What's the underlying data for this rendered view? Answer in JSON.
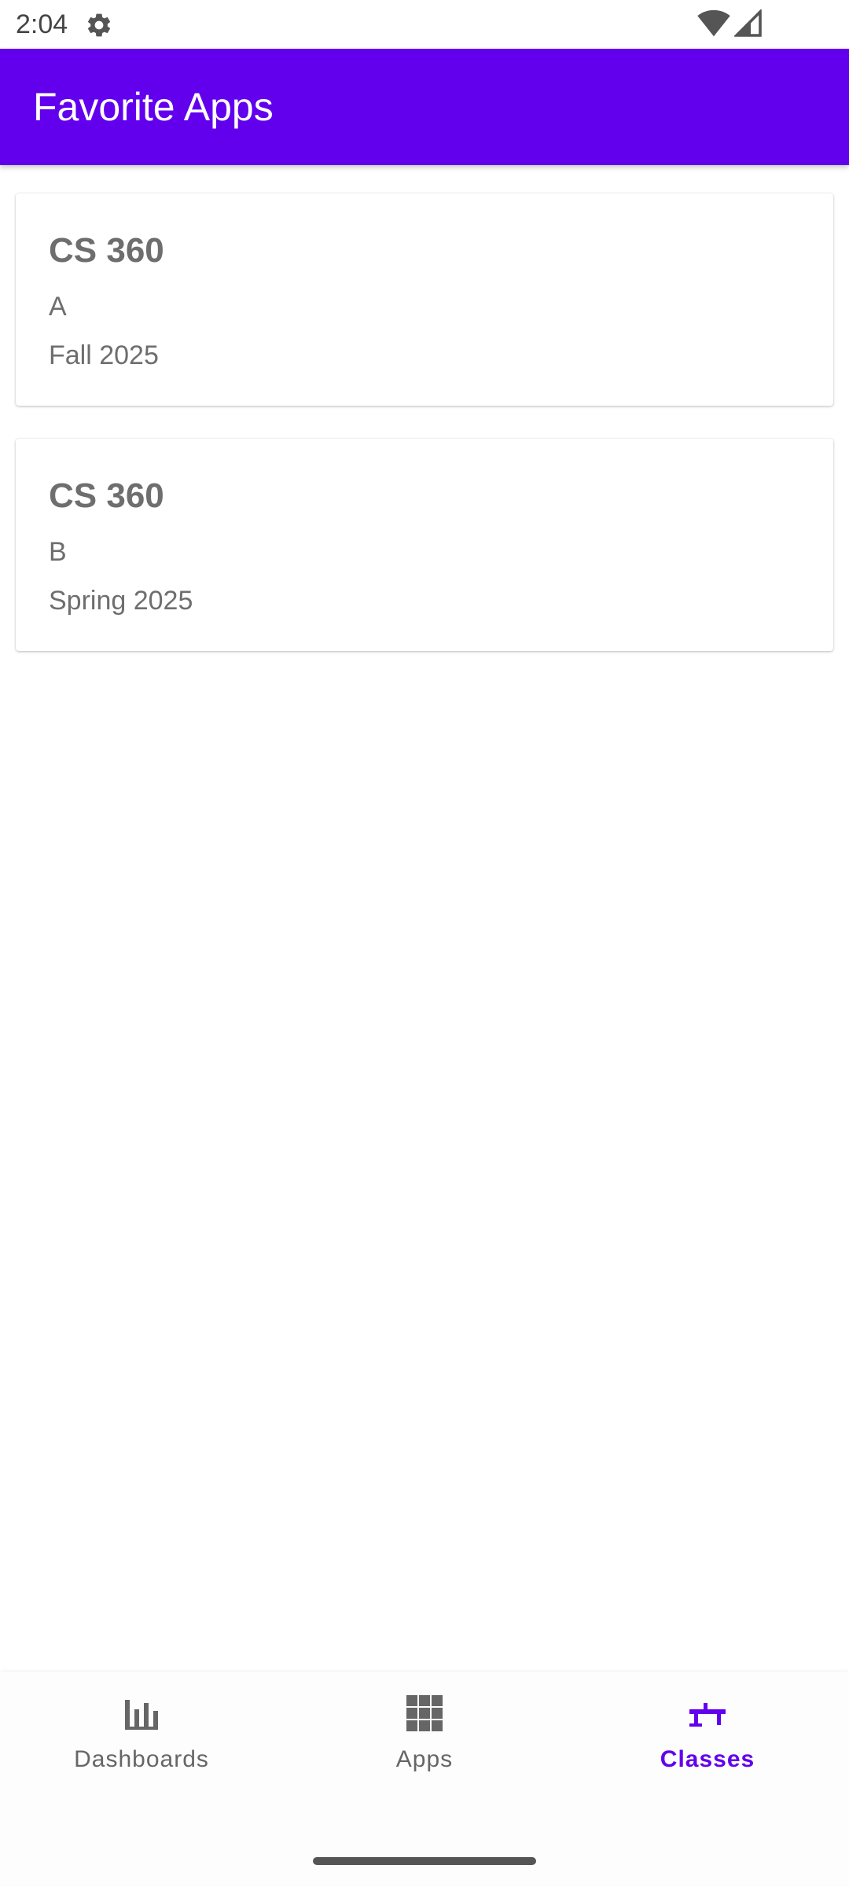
{
  "status_bar": {
    "time": "2:04",
    "icons": [
      "settings-gear-icon",
      "wifi-icon",
      "cell-signal-icon"
    ]
  },
  "app_bar": {
    "title": "Favorite Apps",
    "color": "#6200ee"
  },
  "cards": [
    {
      "title": "CS 360",
      "section": "A",
      "term": "Fall 2025"
    },
    {
      "title": "CS 360",
      "section": "B",
      "term": "Spring 2025"
    }
  ],
  "bottom_nav": {
    "items": [
      {
        "label": "Dashboards",
        "icon": "bar-chart-icon",
        "active": false
      },
      {
        "label": "Apps",
        "icon": "grid-icon",
        "active": false
      },
      {
        "label": "Classes",
        "icon": "classes-icon",
        "active": true
      }
    ],
    "active_color": "#6200ee",
    "inactive_color": "#666666"
  }
}
